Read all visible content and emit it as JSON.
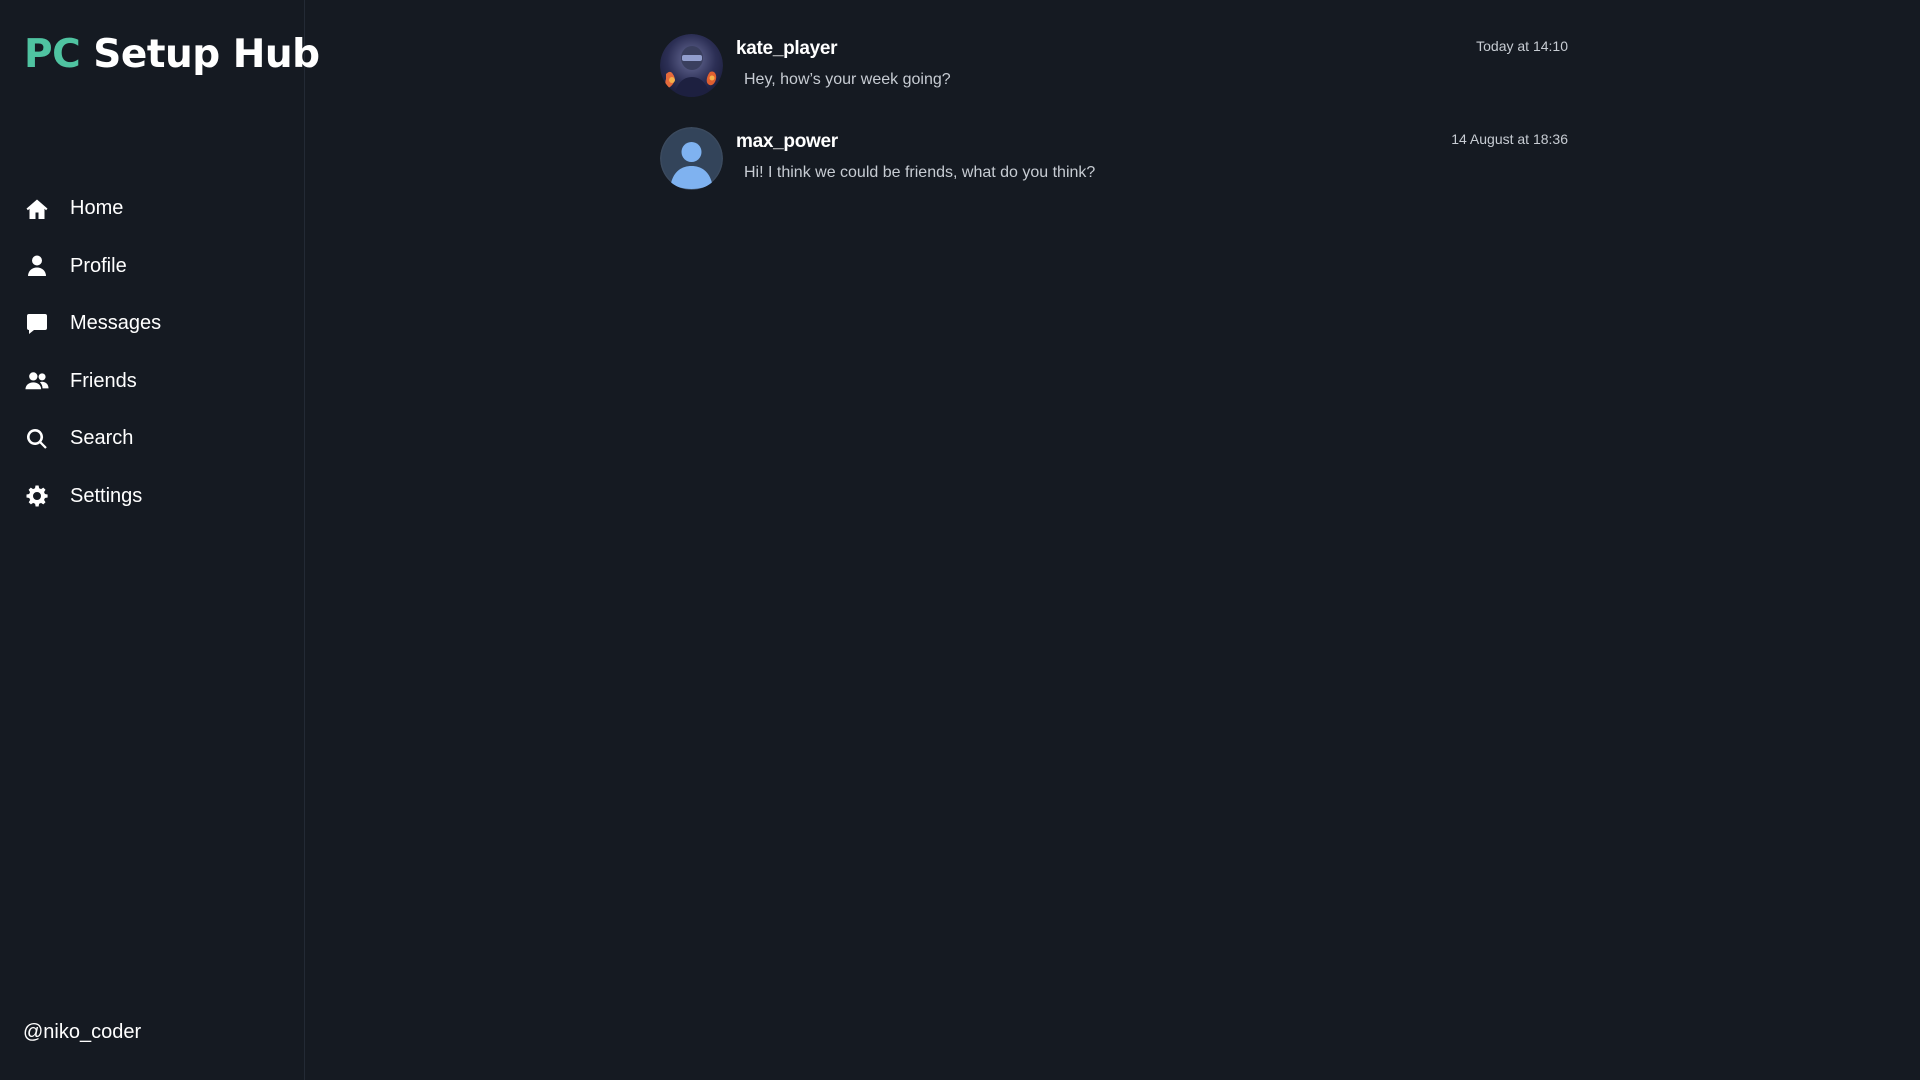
{
  "app": {
    "logo_accent": "PC",
    "logo_rest": " Setup Hub",
    "accent_color": "#4fc3a1",
    "background_color": "#151a22"
  },
  "sidebar": {
    "items": [
      {
        "label": "Home",
        "icon": "home-icon"
      },
      {
        "label": "Profile",
        "icon": "user-icon"
      },
      {
        "label": "Messages",
        "icon": "message-icon"
      },
      {
        "label": "Friends",
        "icon": "friends-icon"
      },
      {
        "label": "Search",
        "icon": "search-icon"
      },
      {
        "label": "Settings",
        "icon": "gear-icon"
      }
    ],
    "username": "@niko_coder"
  },
  "conversations": [
    {
      "name": "kate_player",
      "preview": "Hey, how’s your week going?",
      "time": "Today at 14:10",
      "avatar": "photo-avatar"
    },
    {
      "name": "max_power",
      "preview": "Hi! I think we could be friends, what do you think?",
      "time": "14 August at 18:36",
      "avatar": "default-avatar"
    }
  ]
}
